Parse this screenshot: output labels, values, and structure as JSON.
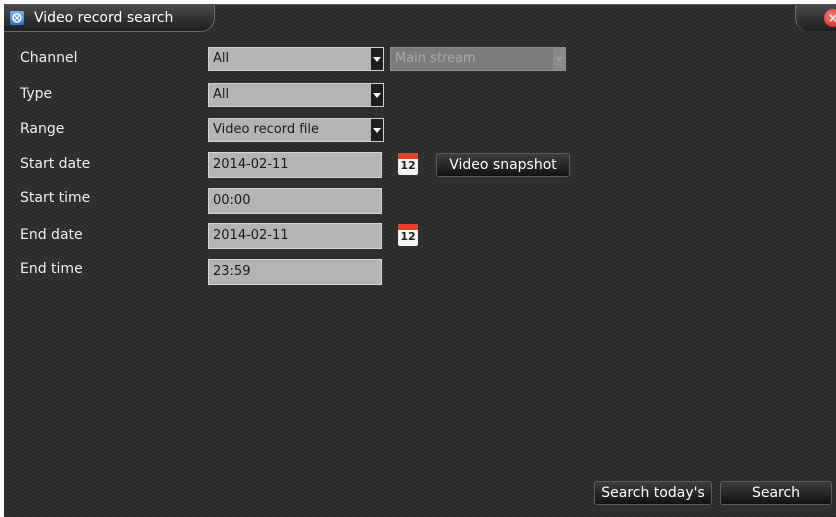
{
  "window": {
    "title": "Video record search"
  },
  "form": {
    "channel": {
      "label": "Channel",
      "value": "All",
      "stream": "Main stream"
    },
    "type": {
      "label": "Type",
      "value": "All"
    },
    "range": {
      "label": "Range",
      "value": "Video record file"
    },
    "start_date": {
      "label": "Start date",
      "value": "2014-02-11"
    },
    "start_time": {
      "label": "Start time",
      "value": "00:00"
    },
    "end_date": {
      "label": "End date",
      "value": "2014-02-11"
    },
    "end_time": {
      "label": "End time",
      "value": "23:59"
    }
  },
  "calendar_icon": {
    "day": "12"
  },
  "buttons": {
    "video_snapshot": "Video snapshot",
    "search_today": "Search today's",
    "search": "Search"
  },
  "icons": {
    "app": "app-icon",
    "close": "close-icon",
    "dropdown": "chevron-down-icon",
    "calendar": "calendar-icon"
  },
  "colors": {
    "window_bg": "#2a2a2a",
    "field_bg": "#b4b4b4",
    "close_red": "#c81818",
    "calendar_red": "#e0452a"
  }
}
